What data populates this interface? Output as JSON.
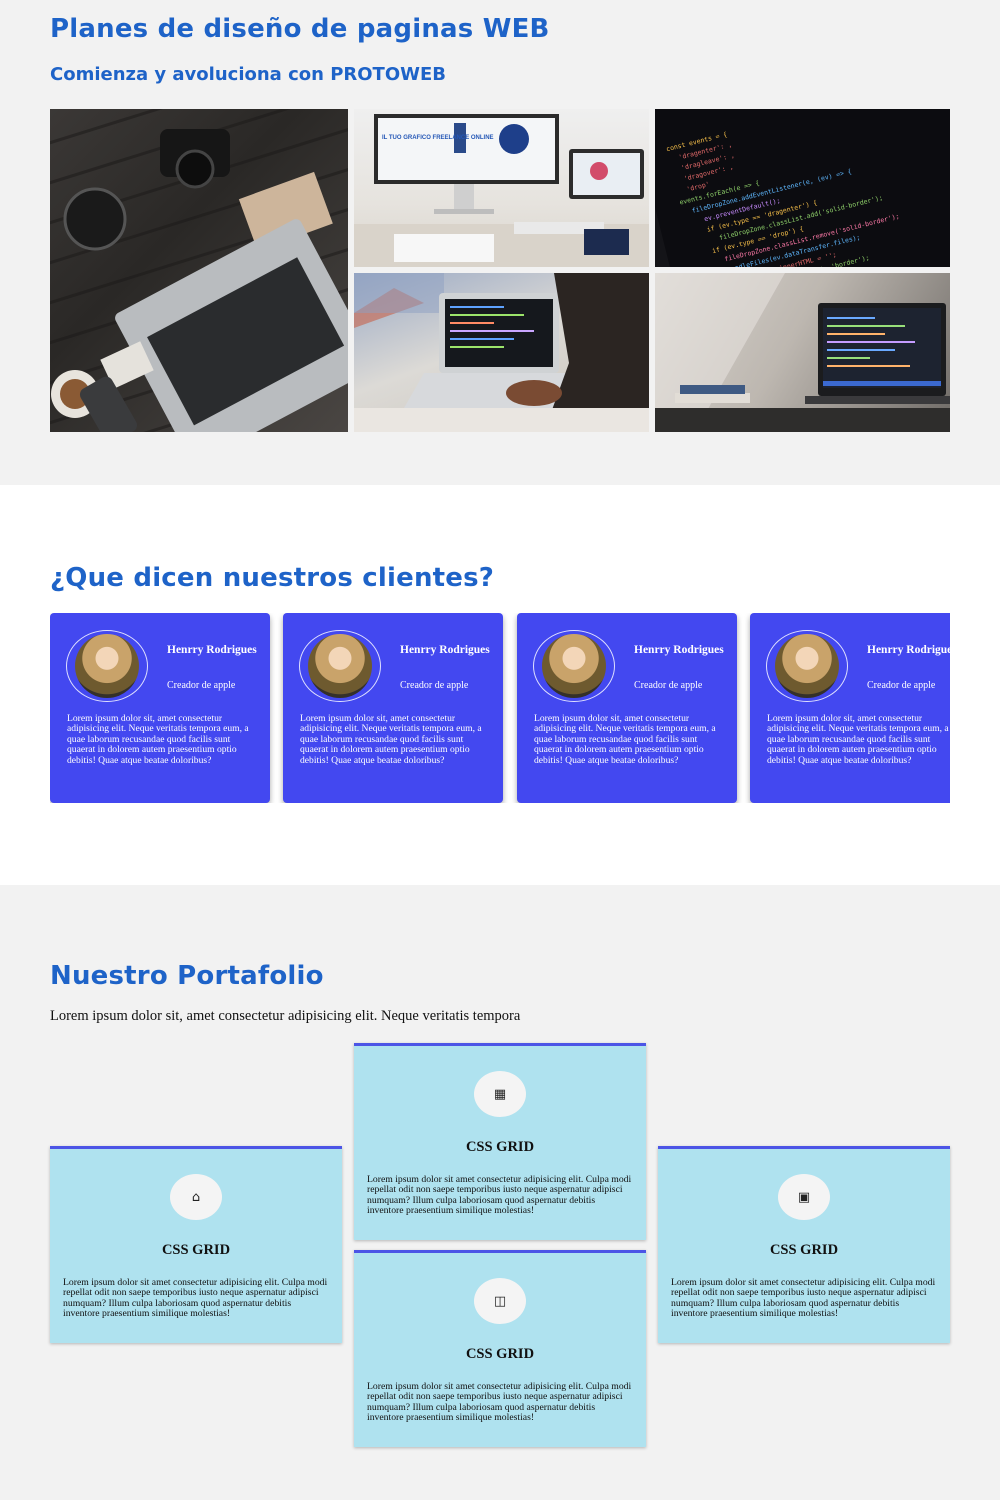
{
  "planes": {
    "title": "Planes de diseño de paginas WEB",
    "subtitle": "Comienza y avoluciona con PROTOWEB",
    "photo2_text": "IL TUO GRAFICO FREELANCE ONLINE"
  },
  "clients": {
    "title": "¿Que dicen nuestros clientes?",
    "cards": [
      {
        "name": "Henrry Rodrigues",
        "role": "Creador de apple",
        "text": "Lorem ipsum dolor sit, amet consectetur adipisicing elit. Neque veritatis tempora eum, a quae laborum recusandae quod facilis sunt quaerat in dolorem autem praesentium optio debitis! Quae atque beatae doloribus?"
      },
      {
        "name": "Henrry Rodrigues",
        "role": "Creador de apple",
        "text": "Lorem ipsum dolor sit, amet consectetur adipisicing elit. Neque veritatis tempora eum, a quae laborum recusandae quod facilis sunt quaerat in dolorem autem praesentium optio debitis! Quae atque beatae doloribus?"
      },
      {
        "name": "Henrry Rodrigues",
        "role": "Creador de apple",
        "text": "Lorem ipsum dolor sit, amet consectetur adipisicing elit. Neque veritatis tempora eum, a quae laborum recusandae quod facilis sunt quaerat in dolorem autem praesentium optio debitis! Quae atque beatae doloribus?"
      },
      {
        "name": "Henrry Rodrigues",
        "role": "Creador de apple",
        "text": "Lorem ipsum dolor sit, amet consectetur adipisicing elit. Neque veritatis tempora eum, a quae laborum recusandae quod facilis sunt quaerat in dolorem autem praesentium optio debitis! Quae atque beatae doloribus?"
      }
    ]
  },
  "portfolio": {
    "title": "Nuestro Portafolio",
    "intro": "Lorem ipsum dolor sit, amet consectetur adipisicing elit. Neque veritatis tempora",
    "cards": [
      {
        "icon": "building-icon",
        "glyph": "▦",
        "title": "CSS GRID",
        "text": "Lorem ipsum dolor sit amet consectetur adipisicing elit. Culpa modi repellat odit non saepe temporibus iusto neque aspernatur adipisci numquam? Illum culpa laboriosam quod aspernatur debitis inventore praesentium similique molestias!"
      },
      {
        "icon": "store-icon",
        "glyph": "⌂",
        "title": "CSS GRID",
        "text": "Lorem ipsum dolor sit amet consectetur adipisicing elit. Culpa modi repellat odit non saepe temporibus iusto neque aspernatur adipisci numquam? Illum culpa laboriosam quod aspernatur debitis inventore praesentium similique molestias!"
      },
      {
        "icon": "qr-code-icon",
        "glyph": "▣",
        "title": "CSS GRID",
        "text": "Lorem ipsum dolor sit amet consectetur adipisicing elit. Culpa modi repellat odit non saepe temporibus iusto neque aspernatur adipisci numquam? Illum culpa laboriosam quod aspernatur debitis inventore praesentium similique molestias!"
      },
      {
        "icon": "office-icon",
        "glyph": "◫",
        "title": "CSS GRID",
        "text": "Lorem ipsum dolor sit amet consectetur adipisicing elit. Culpa modi repellat odit non saepe temporibus iusto neque aspernatur adipisci numquam? Illum culpa laboriosam quod aspernatur debitis inventore praesentium similique molestias!"
      }
    ]
  },
  "colors": {
    "heading": "#1e63c8",
    "client_card": "#4348f0",
    "portfolio_card": "#afe2ef",
    "portfolio_border": "#4c55e6"
  }
}
